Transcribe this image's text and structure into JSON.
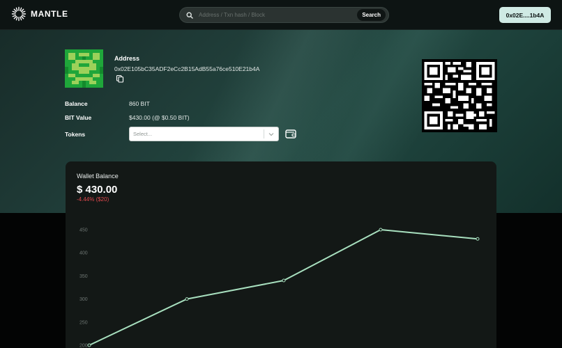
{
  "header": {
    "logo_text": "MANTLE",
    "logo_icon": "mantle-sunburst-icon",
    "search": {
      "placeholder": "Address / Txn hash / Block",
      "button_label": "Search"
    },
    "wallet_button_label": "0x02E....1b4A"
  },
  "profile": {
    "address_label": "Address",
    "address_value": "0x02E105bC35ADF2eCc2B15AdB55a76ce510E21b4A",
    "copy_icon": "copy-icon",
    "balance_label": "Balance",
    "balance_value": "860 BIT",
    "bit_value_label": "BIT Value",
    "bit_value_value": "$430.00 (@ $0.50 BIT)",
    "tokens_label": "Tokens",
    "tokens_select_placeholder": "Select...",
    "wallet_icon": "wallet-icon"
  },
  "card": {
    "title": "Wallet Balance",
    "amount": "$ 430.00",
    "change": "-4.44% ($20)"
  },
  "colors": {
    "accent": "#cfeae4",
    "line": "#a8e0bf",
    "negative": "#e0484d"
  },
  "chart_data": {
    "type": "line",
    "title": "",
    "xlabel": "",
    "ylabel": "",
    "y_ticks": [
      200,
      250,
      300,
      350,
      400,
      450
    ],
    "ylim": [
      200,
      450
    ],
    "grid": false,
    "series": [
      {
        "values": [
          200,
          300,
          340,
          450,
          430
        ]
      }
    ]
  }
}
